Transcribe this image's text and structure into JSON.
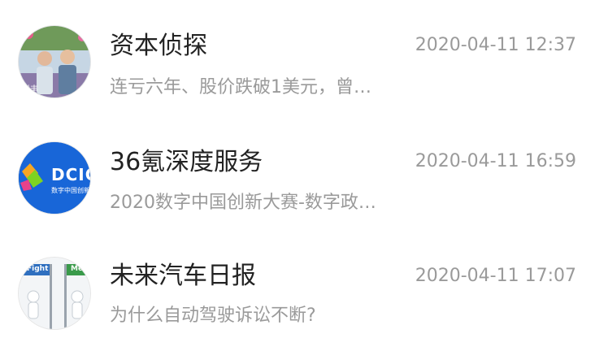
{
  "items": [
    {
      "title": "资本侦探",
      "time": "2020-04-11 12:37",
      "preview": "连亏六年、股价跌破1美元，曾…",
      "avatar_text": "锐丰"
    },
    {
      "title": "36氪深度服务",
      "time": "2020-04-11 16:59",
      "preview": "2020数字中国创新大赛-数字政…",
      "avatar_text": "DCIC",
      "avatar_subtext": "数字中国创新"
    },
    {
      "title": "未来汽车日报",
      "time": "2020-04-11 17:07",
      "preview": "为什么自动驾驶诉讼不断?",
      "avatar_text": "Fight",
      "avatar_text_2": "Me"
    }
  ],
  "colors": {
    "title": "#222222",
    "meta": "#9a9a9a",
    "brand_blue": "#1866d8"
  }
}
